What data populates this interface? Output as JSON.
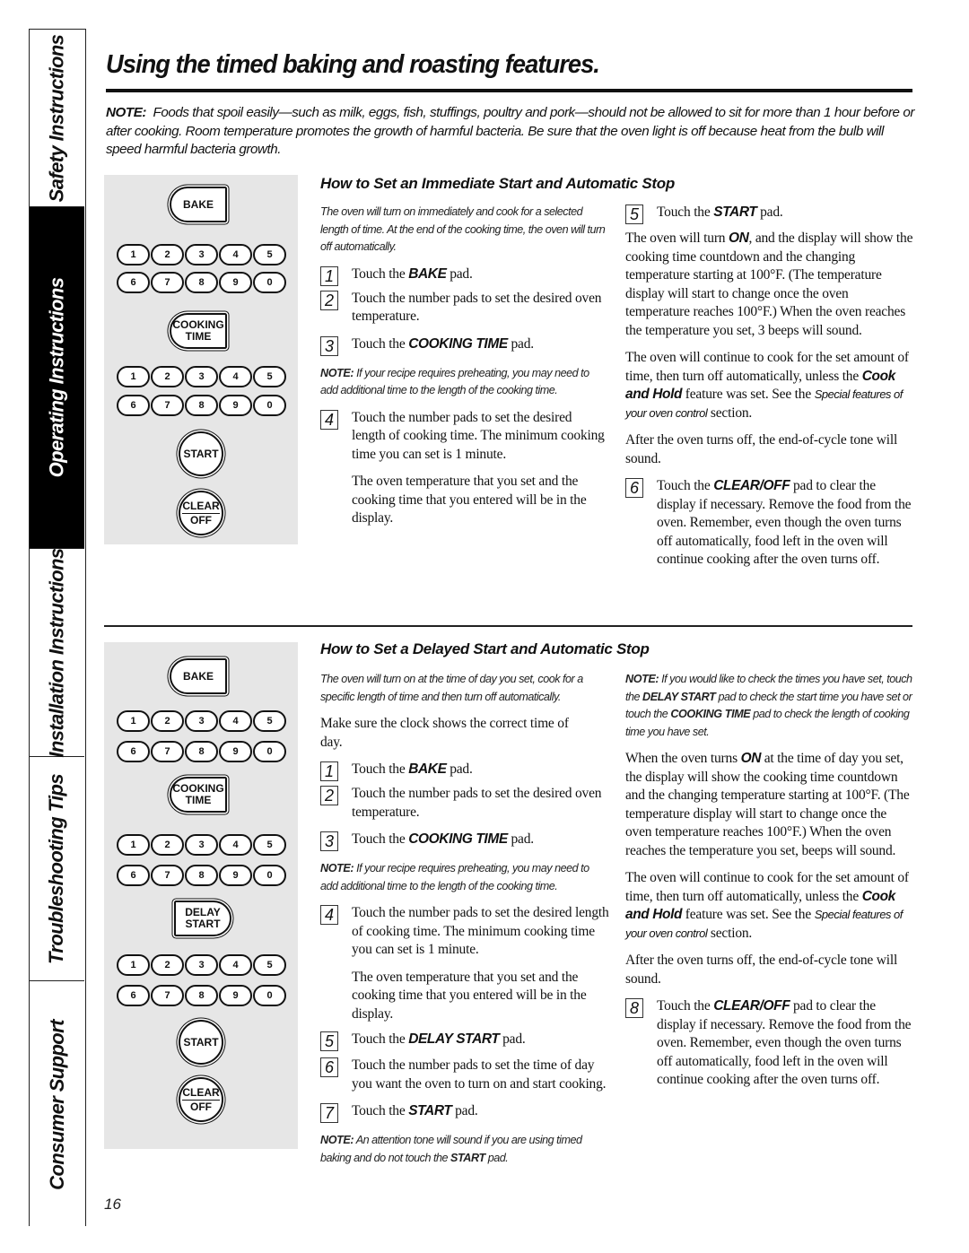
{
  "side_tabs": [
    {
      "label": "Safety Instructions",
      "active": false
    },
    {
      "label": "Operating Instructions",
      "active": true
    },
    {
      "label": "Installation Instructions",
      "active": false
    },
    {
      "label": "Troubleshooting Tips",
      "active": false
    },
    {
      "label": "Consumer Support",
      "active": false
    }
  ],
  "header": {
    "title": "Using the timed baking and roasting features.",
    "note_label": "NOTE:",
    "note_text": "Foods that spoil easily—such as milk, eggs, fish, stuffings, poultry and pork—should not be allowed to sit for more than 1 hour before or after cooking. Room temperature promotes the growth of harmful bacteria. Be sure that the oven light is off because heat from the bulb will speed harmful bacteria growth."
  },
  "keypad": {
    "bake": "BAKE",
    "cooking_line1": "COOKING",
    "cooking_line2": "TIME",
    "delay_line1": "DELAY",
    "delay_line2": "START",
    "start": "START",
    "clear_top": "CLEAR",
    "clear_bottom": "OFF",
    "row1": [
      "1",
      "2",
      "3",
      "4",
      "5"
    ],
    "row2": [
      "6",
      "7",
      "8",
      "9",
      "0"
    ]
  },
  "immediate": {
    "heading": "How to Set an Immediate Start and Automatic Stop",
    "intro": "The oven will turn on immediately and cook for a selected length of time. At the end of the cooking time, the oven will turn off automatically.",
    "step1": {
      "num": "1",
      "pre": "Touch the ",
      "bold": "BAKE",
      "post": " pad."
    },
    "step2": {
      "num": "2",
      "text": "Touch the number pads to set the desired oven temperature."
    },
    "step3": {
      "num": "3",
      "pre": "Touch the ",
      "bold": "COOKING TIME",
      "post": " pad."
    },
    "note_label": "NOTE:",
    "note_text": " If your recipe requires preheating, you may need to add additional time to the length of the cooking time.",
    "step4": {
      "num": "4",
      "text": "Touch the number pads to set the desired length of cooking time. The minimum cooking time you can set is 1 minute."
    },
    "step4_sub": "The oven temperature that you set and the cooking time that you entered will be in the display.",
    "step5": {
      "num": "5",
      "pre": "Touch the ",
      "bold": "START",
      "post": " pad."
    },
    "para1_pre": "The oven will turn ",
    "para1_bold": "ON",
    "para1_post": ", and the display will show the cooking time countdown and the changing temperature starting at 100°F. (The temperature display will start to change once the oven temperature reaches 100°F.) When the oven reaches the temperature you set, 3 beeps will sound.",
    "para2_pre": "The oven will continue to cook for the set amount of time, then turn off automatically, unless the ",
    "para2_bold": "Cook and Hold",
    "para2_mid": " feature was set. See the ",
    "para2_ital": "Special features of your oven control",
    "para2_post": " section.",
    "para3": "After the oven turns off, the end-of-cycle tone will sound.",
    "step6": {
      "num": "6",
      "pre": "Touch the ",
      "bold": "CLEAR/OFF",
      "post": " pad to clear the display if necessary. Remove the food from the oven. Remember, even though the oven turns off automatically, food left in the oven will continue cooking after the oven turns off."
    }
  },
  "delayed": {
    "heading": "How to Set a Delayed Start and Automatic Stop",
    "intro": "The oven will turn on at the time of day you set, cook for a specific length of time and then turn off automatically.",
    "clock_para": "Make sure the clock shows the correct time of day.",
    "step1": {
      "num": "1",
      "pre": "Touch the ",
      "bold": "BAKE",
      "post": " pad."
    },
    "step2": {
      "num": "2",
      "text": "Touch the number pads to set the desired oven temperature."
    },
    "step3": {
      "num": "3",
      "pre": "Touch the ",
      "bold": "COOKING TIME",
      "post": " pad."
    },
    "note1_label": "NOTE:",
    "note1_text": " If your recipe requires preheating, you may need to add additional time to the length of the cooking time.",
    "step4": {
      "num": "4",
      "text": "Touch the number pads to set the desired length of cooking time. The minimum cooking time you can set is 1 minute."
    },
    "step4_sub": "The oven temperature that you set and the cooking time that you entered will be in the display.",
    "step5": {
      "num": "5",
      "pre": "Touch the ",
      "bold": "DELAY START",
      "post": " pad."
    },
    "step6": {
      "num": "6",
      "text": "Touch the number pads to set the time of day you want the oven to turn on and start cooking."
    },
    "step7": {
      "num": "7",
      "pre": "Touch the ",
      "bold": "START",
      "post": " pad."
    },
    "note2_label": "NOTE:",
    "note2_pre": " An attention tone will sound if you are using timed baking and do not touch the ",
    "note2_bold": "START",
    "note2_post": " pad.",
    "rnote_label": "NOTE:",
    "rnote_pre": " If you would like to check the times you have set, touch the ",
    "rnote_bold1": "DELAY START",
    "rnote_mid": " pad to check the start time you have set or touch the ",
    "rnote_bold2": "COOKING TIME",
    "rnote_post": "  pad to check the length of cooking time you have set.",
    "para1_pre": "When the oven turns ",
    "para1_bold": "ON",
    "para1_post": " at the time of day you set, the display will show the cooking time countdown and the changing temperature starting at 100°F. (The temperature display will start to change once the oven temperature reaches 100°F.) When the oven reaches the temperature you set, beeps will sound.",
    "para2_pre": "The oven will continue to cook for the set amount of time, then turn off automatically, unless the ",
    "para2_bold": "Cook and Hold",
    "para2_mid": " feature was set. See the ",
    "para2_ital": "Special features of your oven control",
    "para2_post": " section.",
    "para3": "After the oven turns off, the end-of-cycle tone will sound.",
    "step8": {
      "num": "8",
      "pre": "Touch the ",
      "bold": "CLEAR/OFF",
      "post": " pad to clear the display if necessary. Remove the food from the oven. Remember, even though the oven turns off automatically, food left in the oven will continue cooking after the oven turns off."
    }
  },
  "page_number": "16"
}
